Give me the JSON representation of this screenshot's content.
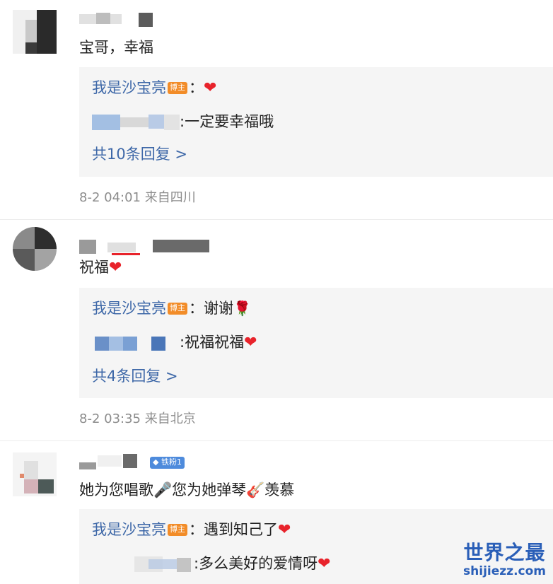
{
  "comments": [
    {
      "text": "宝哥，幸福",
      "replies": [
        {
          "author": "我是沙宝亮",
          "badge": "博主",
          "colon": "：",
          "text": "",
          "icon": "heart-icon"
        },
        {
          "author": "",
          "colon": ":",
          "text": "一定要幸福哦"
        }
      ],
      "more_label": "共10条回复 >",
      "meta": "8-2 04:01 来自四川"
    },
    {
      "text": "祝福",
      "replies": [
        {
          "author": "我是沙宝亮",
          "badge": "博主",
          "colon": "：",
          "text": "谢谢",
          "icon": "rose-icon"
        },
        {
          "author": "",
          "colon": ":",
          "text": "祝福祝福",
          "icon": "heart-icon"
        }
      ],
      "more_label": "共4条回复 >",
      "meta": "8-2 03:35 来自北京"
    },
    {
      "fan_badge": "铁粉1",
      "text": "她为您唱歌🎤您为她弹琴🎸羡慕",
      "replies": [
        {
          "author": "我是沙宝亮",
          "badge": "博主",
          "colon": "：",
          "text": "遇到知己了",
          "icon": "heart-icon"
        },
        {
          "author": "",
          "colon": ":",
          "text": "多么美好的爱情呀",
          "icon": "heart-icon"
        }
      ]
    }
  ],
  "watermark": {
    "cn": "世界之最",
    "en": "shijiezz.com"
  },
  "colors": {
    "author": "#3e68a8",
    "heart": "#e8232b",
    "badge": "#f28c28",
    "meta": "#8c8c8c",
    "reply_bg": "#f5f5f5"
  }
}
